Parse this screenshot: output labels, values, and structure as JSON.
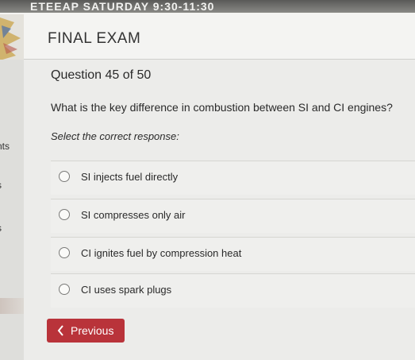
{
  "banner": {
    "text": "ETEEAP SATURDAY 9:30-11:30"
  },
  "header": {
    "title": "FINAL EXAM"
  },
  "sidebar": {
    "items": [
      "nts",
      "s",
      "s",
      ")"
    ]
  },
  "question": {
    "number_label": "Question 45 of 50",
    "text": "What is the key difference in combustion between SI and CI engines?",
    "instruction": "Select the correct response:",
    "options": [
      "SI injects fuel directly",
      "SI compresses only air",
      "CI ignites fuel by compression heat",
      "CI uses spark plugs"
    ]
  },
  "navigation": {
    "previous_label": "Previous",
    "previous_icon": "chevron-left-icon"
  },
  "colors": {
    "accent": "#b9333a",
    "background": "#ececea"
  }
}
